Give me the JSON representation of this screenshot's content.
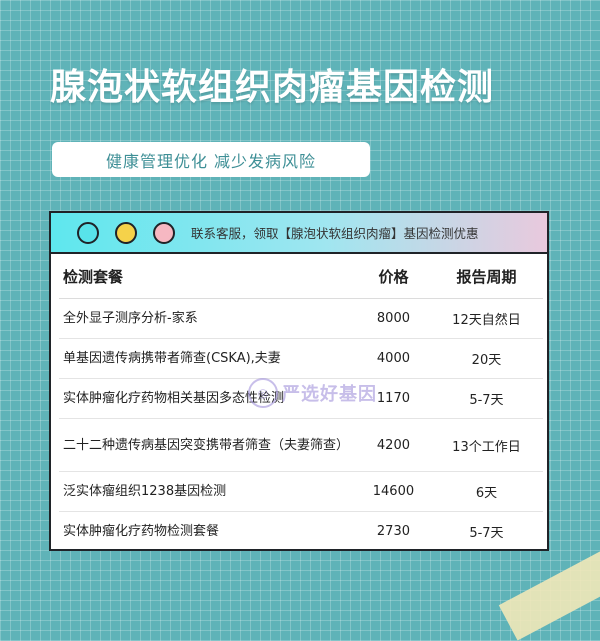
{
  "page": {
    "title": "腺泡状软组织肉瘤基因检测",
    "subtitle": "健康管理优化 减少发病风险"
  },
  "card": {
    "header_text": "联系客服，领取【腺泡状软组织肉瘤】基因检测优惠",
    "columns": [
      "检测套餐",
      "价格",
      "报告周期"
    ],
    "rows": [
      {
        "name": "全外显子测序分析-家系",
        "price": "8000",
        "period": "12天自然日"
      },
      {
        "name": "单基因遗传病携带者筛查(CSKA),夫妻",
        "price": "4000",
        "period": "20天"
      },
      {
        "name": "实体肿瘤化疗药物相关基因多态性检测",
        "price": "1170",
        "period": "5-7天"
      },
      {
        "name": "二十二种遗传病基因突变携带者筛查（夫妻筛查）",
        "price": "4200",
        "period": "13个工作日"
      },
      {
        "name": "泛实体瘤组织1238基因检测",
        "price": "14600",
        "period": "6天"
      },
      {
        "name": "实体肿瘤化疗药物检测套餐",
        "price": "2730",
        "period": "5-7天"
      }
    ]
  },
  "watermark": {
    "text": "严选好基因",
    "icon": "brand-logo-icon"
  },
  "colors": {
    "background": "#5fb3b8",
    "title": "#ffffff",
    "header_gradient_start": "#5ee7ee",
    "header_gradient_end": "#e9c9dd",
    "dot_cyan": "#58e3ea",
    "dot_yellow": "#f5d24a",
    "dot_pink": "#f6b8c2"
  }
}
